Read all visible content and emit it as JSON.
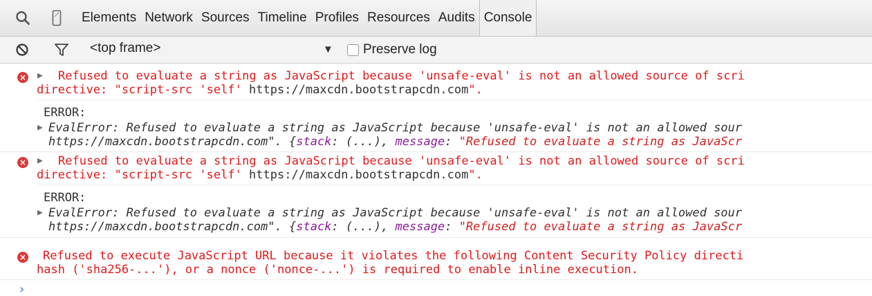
{
  "toolbar": {
    "icons": [
      "search-icon",
      "device-mode-icon"
    ],
    "tabs": [
      "Elements",
      "Network",
      "Sources",
      "Timeline",
      "Profiles",
      "Resources",
      "Audits",
      "Console"
    ],
    "selected_tab": "Console"
  },
  "console_toolbar": {
    "frame_value": "<top frame>",
    "preserve_log_label": "Preserve log",
    "preserve_log_checked": false
  },
  "messages": [
    {
      "level": "error",
      "line1": "Refused to evaluate a string as JavaScript because 'unsafe-eval' is not an allowed source of scri",
      "line2_prefix": "directive: \"script-src 'self'",
      "line2_url": " https://maxcdn.bootstrapcdn.com",
      "line2_suffix": "\".",
      "sub_label": "ERROR:",
      "detail_line1": "EvalError: Refused to evaluate a string as JavaScript because 'unsafe-eval' is not an allowed sour",
      "detail_line2_a": "https://maxcdn.bootstrapcdn.com\". {",
      "detail_prop1": "stack",
      "detail_line2_b": ": (...), ",
      "detail_prop2": "message",
      "detail_line2_c": ": ",
      "detail_str": "\"Refused to evaluate a string as JavaScr"
    },
    {
      "level": "error",
      "line1": "Refused to evaluate a string as JavaScript because 'unsafe-eval' is not an allowed source of scri",
      "line2_prefix": "directive: \"script-src 'self'",
      "line2_url": " https://maxcdn.bootstrapcdn.com",
      "line2_suffix": "\".",
      "sub_label": "ERROR:",
      "detail_line1": "EvalError: Refused to evaluate a string as JavaScript because 'unsafe-eval' is not an allowed sour",
      "detail_line2_a": "https://maxcdn.bootstrapcdn.com\". {",
      "detail_prop1": "stack",
      "detail_line2_b": ": (...), ",
      "detail_prop2": "message",
      "detail_line2_c": ": ",
      "detail_str": "\"Refused to evaluate a string as JavaScr"
    },
    {
      "level": "error",
      "line1": "Refused to execute JavaScript URL because it violates the following Content Security Policy directi",
      "line2": "hash ('sha256-...'), or a nonce ('nonce-...') is required to enable inline execution."
    }
  ],
  "prompt_symbol": "›",
  "colors": {
    "error_text": "#e0191b",
    "error_icon": "#d93a3a",
    "prompt": "#2e7bd6",
    "object_property": "#8b1d99"
  }
}
